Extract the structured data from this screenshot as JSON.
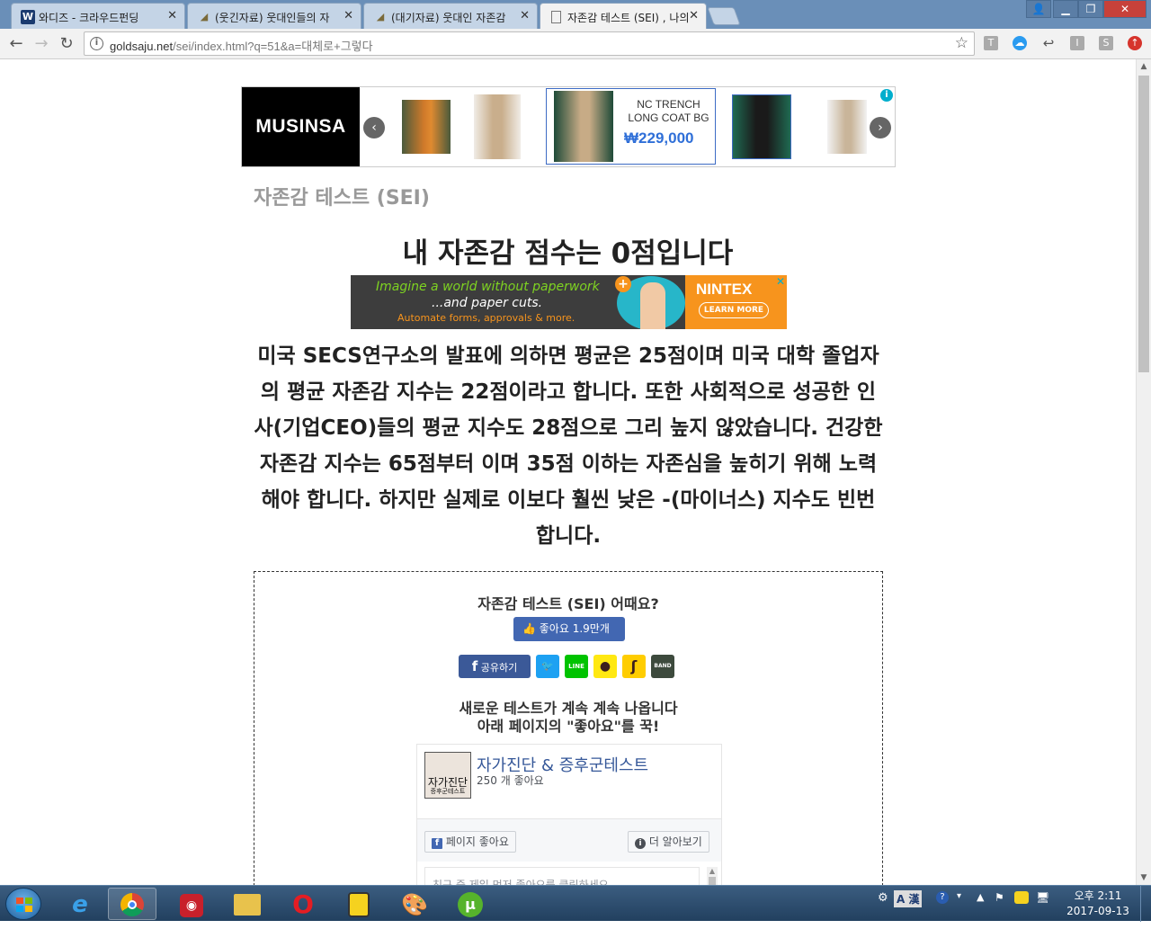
{
  "tabs": [
    {
      "title": "와디즈 - 크라우드펀딩",
      "icon": "W"
    },
    {
      "title": "(웃긴자료) 웃대인들의 자",
      "icon": "hat"
    },
    {
      "title": "(대기자료) 웃대인 자존감",
      "icon": "hat"
    },
    {
      "title": "자존감 테스트 (SEI) , 나의",
      "icon": "doc"
    }
  ],
  "address": {
    "domain": "goldsaju.net",
    "path": "/sei/index.html?q=51&a=대체로+그렇다"
  },
  "banner": {
    "brand": "MUSINSA",
    "featured_name_line1": "NC TRENCH",
    "featured_name_line2": "LONG COAT BG",
    "featured_price": "₩229,000",
    "colors": {
      "brand_bg": "#000000",
      "price": "#2f6fd8"
    }
  },
  "page": {
    "title": "자존감 테스트 (SEI)",
    "result": "내 자존감 점수는 0점입니다",
    "description": "미국 SECS연구소의 발표에 의하면 평균은 25점이며 미국 대학 졸업자의 평균 자존감 지수는 22점이라고 합니다. 또한 사회적으로 성공한 인사(기업CEO)들의 평균 지수도 28점으로 그리 높지 않았습니다. 건강한 자존감 지수는 65점부터 이며 35점 이하는 자존심을 높히기 위해 노력해야 합니다. 하지만 실제로 이보다 훨씬 낮은 -(마이너스) 지수도 빈번합니다."
  },
  "ad2": {
    "line1": "Imagine a world without paperwork",
    "line2": "...and paper cuts.",
    "line3": "Automate forms, approvals & more.",
    "logo": "NINTEX",
    "cta": "LEARN MORE"
  },
  "share": {
    "question": "자존감 테스트 (SEI) 어때요?",
    "like_label": "좋아요 1.9만개",
    "fb_share": "공유하기",
    "band": "BAND",
    "message_line1": "새로운 테스트가 계속 계속 나옵니다",
    "message_line2": "아래 페이지의 \"좋아요\"를 꾹!"
  },
  "fbpage": {
    "thumb_line1": "자가진단",
    "thumb_line2": "증후군테스트",
    "name": "자가진단 & 증후군테스트",
    "likes": "250 개 좋아요",
    "like_page": "페이지 좋아요",
    "learn_more": "더 알아보기",
    "friends_prompt": "친구 중 제일 먼저 좋아요를 클릭하세요"
  },
  "taskbar": {
    "ime": "A 漢",
    "clock_time": "오후 2:11",
    "clock_date": "2017-09-13"
  }
}
